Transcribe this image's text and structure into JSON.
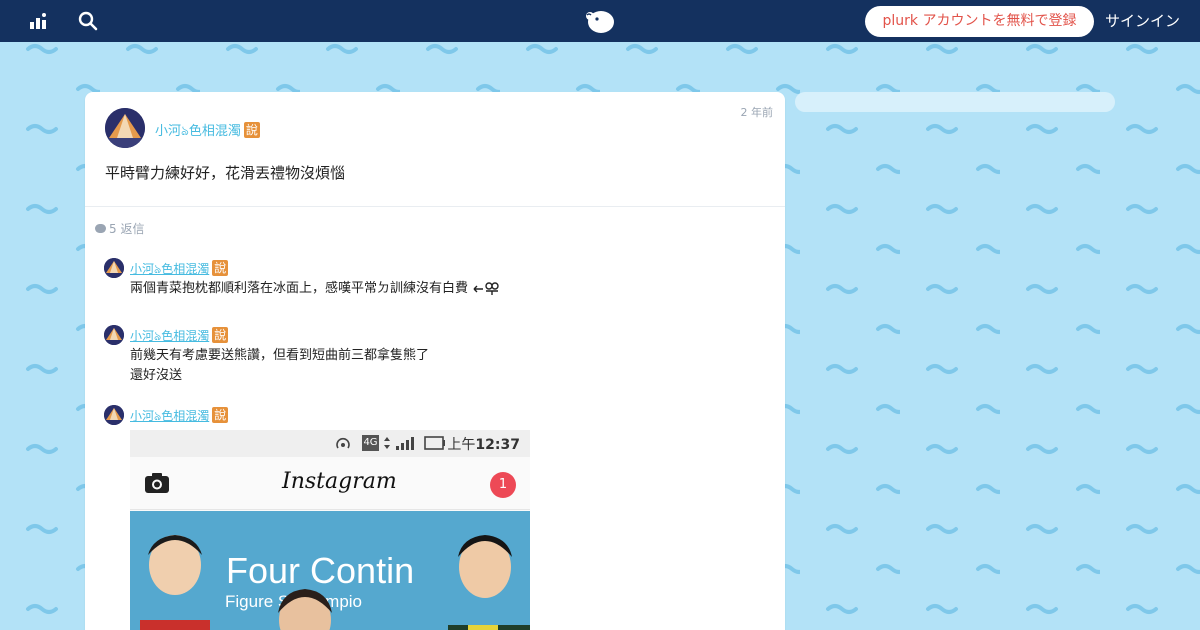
{
  "colors": {
    "background": "#b3e2f7",
    "topbar": "#14315f",
    "accent_link": "#46bbe0",
    "signup_text": "#e2534a",
    "qualifier_badge": "#e6913a",
    "notification_badge": "#ed4956"
  },
  "topbar": {
    "stats_icon": "bar-chart-icon",
    "search_icon": "search-icon",
    "logo_icon": "plurk-logo-icon",
    "signup_label": "plurk アカウントを無料で登録",
    "signin_label": "サインイン"
  },
  "post": {
    "time": "2 年前",
    "author": "小河ঌ色相混濁",
    "qualifier": "說",
    "text": "平時臂力練好好，花滑丟禮物沒煩惱"
  },
  "responses_header": {
    "count_text": "5 返信",
    "icon": "comment-icon"
  },
  "responses": [
    {
      "author": "小河ঌ色相混濁",
      "qualifier": "說",
      "text": "兩個青菜抱枕都順利落在冰面上，感嘆平常ㄉ訓練沒有白費",
      "emote": "emoticon-icon"
    },
    {
      "author": "小河ঌ色相混濁",
      "qualifier": "說",
      "line1": "前幾天有考慮要送熊讚，但看到短曲前三都拿隻熊了",
      "line2": "還好沒送"
    },
    {
      "author": "小河ঌ色相混濁",
      "qualifier": "說"
    }
  ],
  "instagram": {
    "status_4g": "4G",
    "time_prefix": "上午",
    "time": "12:37",
    "wordmark": "Instagram",
    "notification_count": "1",
    "camera_icon": "camera-icon",
    "photo_text_1": "Four Contin",
    "photo_text_2": "Figure  S    Champio"
  }
}
